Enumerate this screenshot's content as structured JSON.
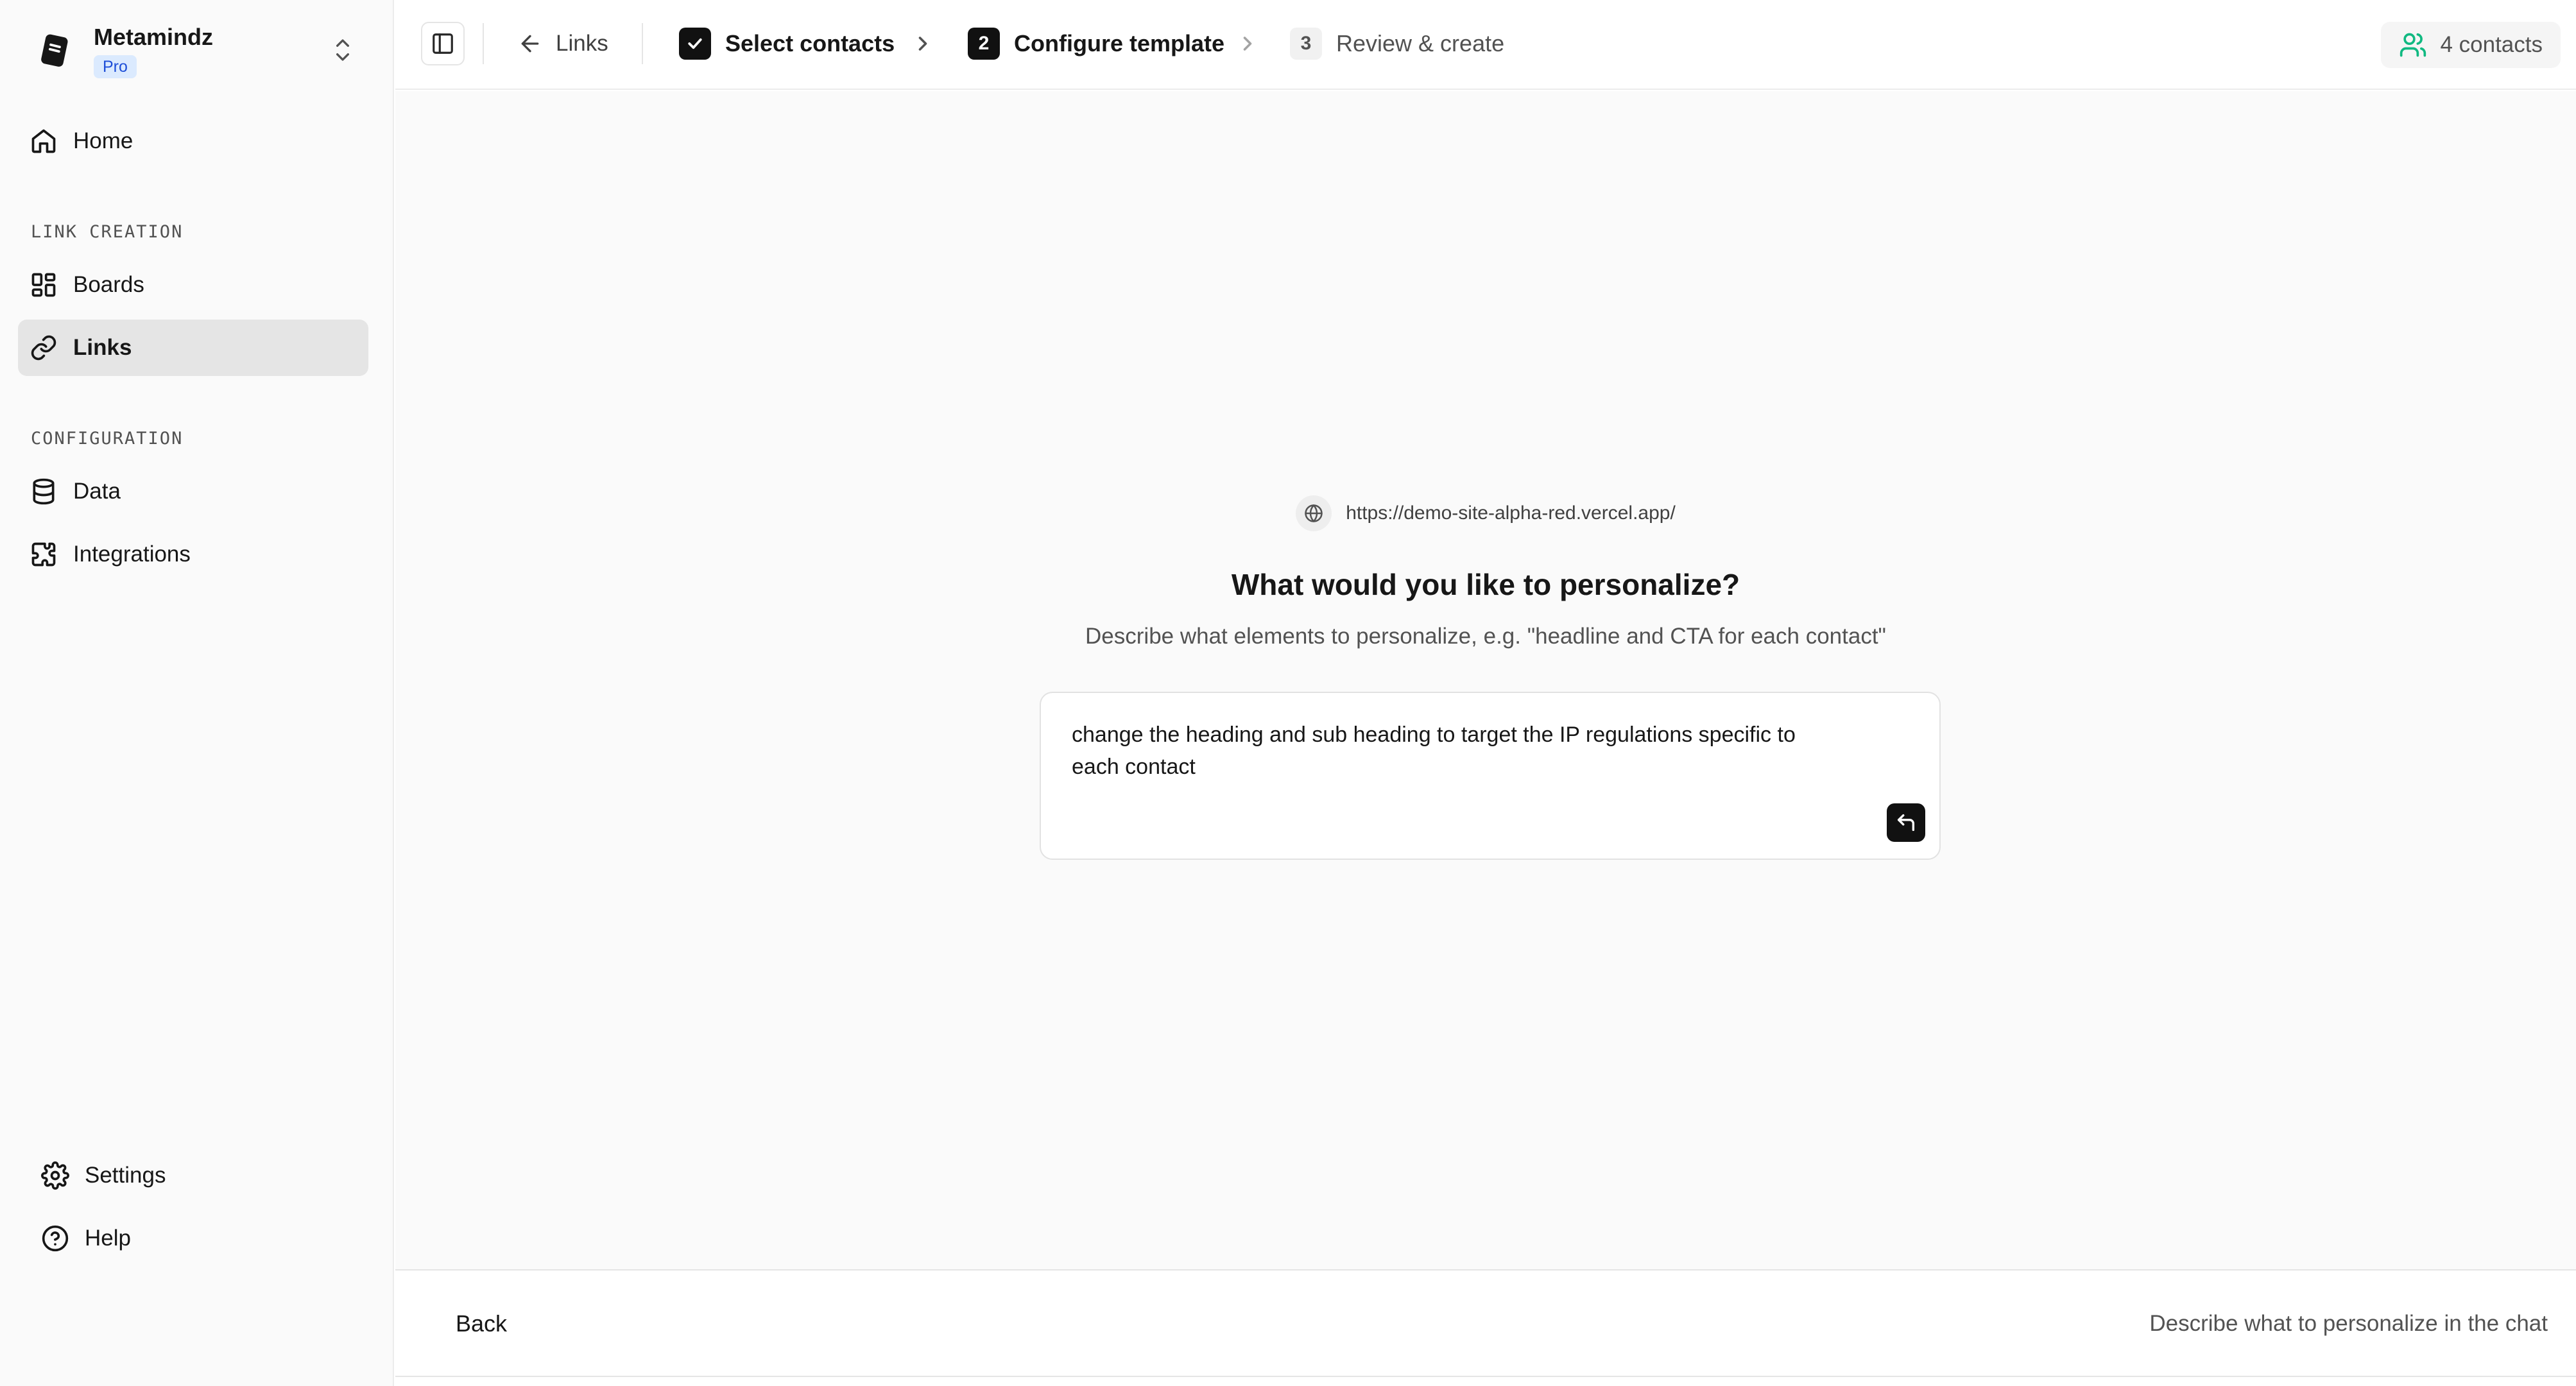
{
  "org": {
    "name": "Metamindz",
    "plan": "Pro"
  },
  "sidebar": {
    "home": "Home",
    "sections": {
      "link_creation": "LINK CREATION",
      "configuration": "CONFIGURATION"
    },
    "items": {
      "boards": "Boards",
      "links": "Links",
      "data": "Data",
      "integrations": "Integrations"
    },
    "bottom": {
      "settings": "Settings",
      "help": "Help"
    }
  },
  "topbar": {
    "back_label": "Links",
    "steps": [
      {
        "number": "",
        "label": "Select contacts",
        "state": "done"
      },
      {
        "number": "2",
        "label": "Configure template",
        "state": "current"
      },
      {
        "number": "3",
        "label": "Review & create",
        "state": "upcoming"
      }
    ],
    "contacts": "4 contacts"
  },
  "main": {
    "url": "https://demo-site-alpha-red.vercel.app/",
    "question": "What would you like to personalize?",
    "hint": "Describe what elements to personalize, e.g. \"headline and CTA for each contact\"",
    "prompt_value": "change the heading and sub heading to target the IP regulations specific to\neach contact"
  },
  "footer": {
    "back": "Back",
    "hint": "Describe what to personalize in the chat"
  },
  "colors": {
    "accent_dark": "#111111",
    "badge_bg": "#dbeafe",
    "badge_text": "#1d4ed8",
    "contacts_icon": "#10b981",
    "sidebar_bg": "#fafafa",
    "active_item_bg": "#e5e5e5"
  },
  "icons": {
    "logo": "notebook-logo",
    "switch": "chevrons-up-down-icon",
    "home": "home-icon",
    "boards": "layout-grid-icon",
    "links": "link-icon",
    "data": "database-icon",
    "integrations": "puzzle-icon",
    "settings": "gear-icon",
    "help": "help-circle-icon",
    "panel": "panel-left-icon",
    "back": "arrow-left-icon",
    "check": "check-icon",
    "chevron": "chevron-right-icon",
    "contacts": "users-icon",
    "globe": "globe-icon",
    "send": "corner-up-left-icon"
  }
}
